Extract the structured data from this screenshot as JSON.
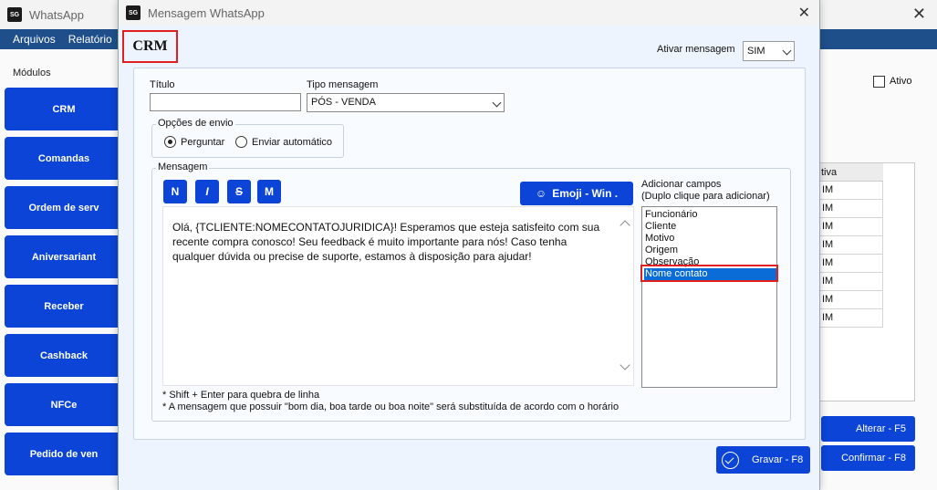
{
  "background": {
    "window_title": "WhatsApp",
    "logo_text": "SG",
    "menu": [
      "Arquivos",
      "Relatório"
    ],
    "modulos_label": "Módulos",
    "modules": [
      "CRM",
      "Comandas",
      "Ordem de serv",
      "Aniversariant",
      "Receber",
      "Cashback",
      "NFCe",
      "Pedido de ven"
    ],
    "ativo_label": "Ativo",
    "table_header": "tiva",
    "table_cells": [
      "IM",
      "IM",
      "IM",
      "IM",
      "IM",
      "IM",
      "IM",
      "IM"
    ],
    "alterar_label": "Alterar - F5",
    "confirmar_label": "Confirmar - F8"
  },
  "dialog": {
    "title": "Mensagem WhatsApp",
    "logo_text": "SG",
    "close_glyph": "✕",
    "heading": "CRM",
    "ativar_label": "Ativar mensagem",
    "ativar_value": "SIM",
    "titulo_label": "Título",
    "titulo_value": "",
    "tipo_label": "Tipo mensagem",
    "tipo_value": "PÓS - VENDA",
    "opcoes_label": "Opções de envio",
    "radio_perguntar": "Perguntar",
    "radio_auto": "Enviar automático",
    "mensagem_label": "Mensagem",
    "format_buttons": [
      "N",
      "I",
      "S",
      "M"
    ],
    "emoji_label": "Emoji - Win .",
    "message_text": "Olá, {TCLIENTE:NOMECONTATOJURIDICA}! Esperamos que esteja satisfeito com sua recente compra conosco! Seu feedback é muito importante para nós! Caso tenha qualquer dúvida ou precise de suporte, estamos à disposição para ajudar!",
    "campos_title_1": "Adicionar campos",
    "campos_title_2": "(Duplo clique para adicionar)",
    "campos": [
      "Funcionário",
      "Cliente",
      "Motivo",
      "Origem",
      "Observação",
      "Nome contato"
    ],
    "selected_campo": "Nome contato",
    "note_1": "* Shift + Enter para quebra de linha",
    "note_2": "* A mensagem que possuir \"bom dia, boa tarde ou boa noite\" será substituída de acordo com o horário",
    "gravar_label": "Gravar - F8"
  },
  "colors": {
    "accent": "#0b44d6",
    "menubar": "#1e4f8a",
    "highlight": "#e02020",
    "selection": "#0a6cd6"
  }
}
